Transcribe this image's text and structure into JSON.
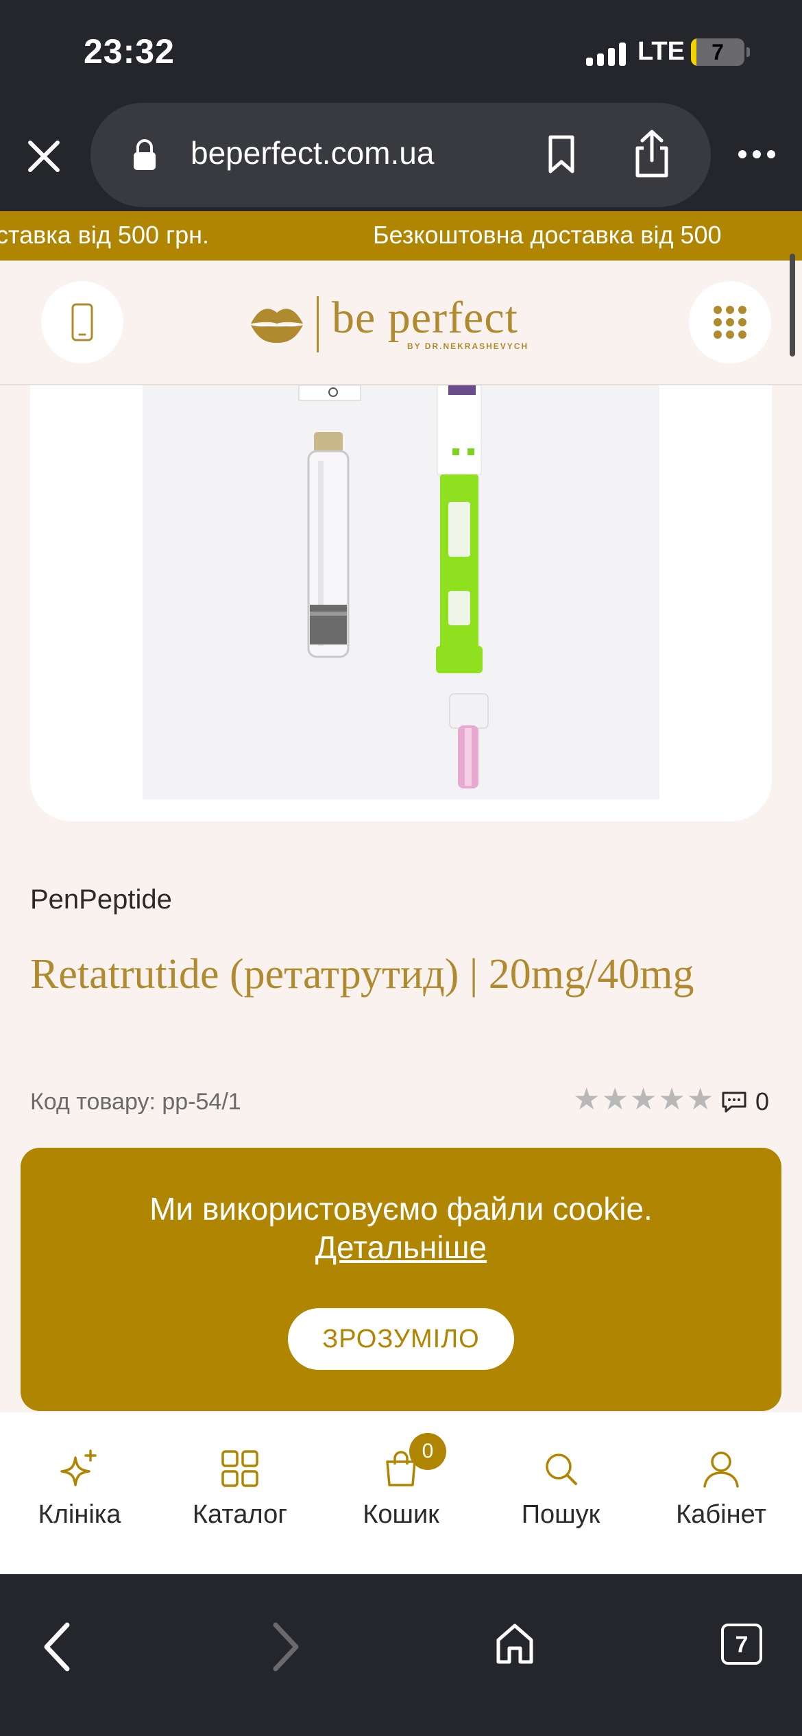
{
  "status_bar": {
    "time": "23:32",
    "network": "LTE",
    "battery": "7"
  },
  "browser": {
    "url": "beperfect.com.ua",
    "tabs_count": "7"
  },
  "promo": {
    "text_left": "ставка від 500 грн.",
    "text_right": "Безкоштовна доставка від 500"
  },
  "logo": {
    "text": "be perfect",
    "subtitle": "BY DR.NEKRASHEVYCH"
  },
  "product": {
    "brand": "PenPeptide",
    "title": "Retatrutide (ретатрутид) | 20mg/40mg",
    "sku": "Код товару: pp-54/1",
    "rating": 0,
    "reviews_count": "0"
  },
  "cookie": {
    "text": "Ми використовуємо файли cookie.",
    "link": "Детальніше",
    "button": "ЗРОЗУМІЛО"
  },
  "bottom_nav": {
    "items": [
      {
        "label": "Клініка",
        "icon": "sparkle-icon"
      },
      {
        "label": "Каталог",
        "icon": "grid-icon"
      },
      {
        "label": "Кошик",
        "icon": "bag-icon",
        "badge": "0"
      },
      {
        "label": "Пошук",
        "icon": "search-icon"
      },
      {
        "label": "Кабінет",
        "icon": "user-icon"
      }
    ]
  },
  "colors": {
    "accent": "#af8502",
    "dark": "#25262b",
    "background": "#faf2ef"
  }
}
